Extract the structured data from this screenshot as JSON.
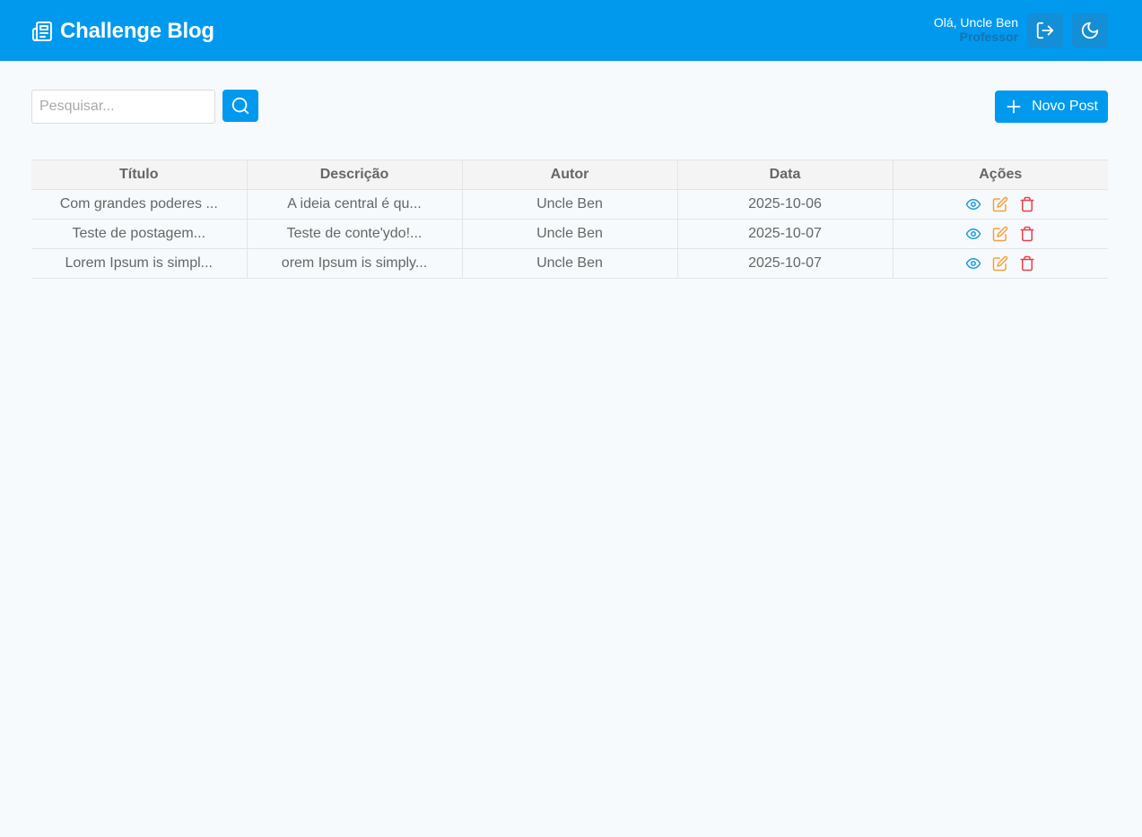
{
  "header": {
    "title": "Challenge Blog",
    "brand_icon": "newspaper-icon",
    "user_greeting": "Olá, Uncle Ben",
    "user_role": "Professor",
    "logout_icon": "logout-icon",
    "theme_icon": "moon-icon"
  },
  "toolbar": {
    "search_placeholder": "Pesquisar...",
    "search_value": "",
    "search_icon": "search-icon",
    "new_post_label": "Novo Post",
    "new_post_icon": "plus-icon"
  },
  "table": {
    "columns": [
      "Título",
      "Descrição",
      "Autor",
      "Data",
      "Ações"
    ],
    "rows": [
      {
        "title": "Com grandes poderes ...",
        "description": "A ideia central é qu...",
        "author": "Uncle Ben",
        "date": "2025-10-06"
      },
      {
        "title": "Teste de postagem...",
        "description": "Teste de conte'ydo!...",
        "author": "Uncle Ben",
        "date": "2025-10-07"
      },
      {
        "title": "Lorem Ipsum is simpl...",
        "description": "orem Ipsum is simply...",
        "author": "Uncle Ben",
        "date": "2025-10-07"
      }
    ],
    "action_icons": [
      "eye-icon",
      "edit-icon",
      "trash-icon"
    ]
  },
  "colors": {
    "primary": "#0099ee",
    "header_button": "#138ed7",
    "role_text": "#1773b0",
    "view_icon": "#1a9bd7",
    "edit_icon": "#f5a03a",
    "delete_icon": "#e8404a",
    "page_bg": "#f6fafd"
  }
}
